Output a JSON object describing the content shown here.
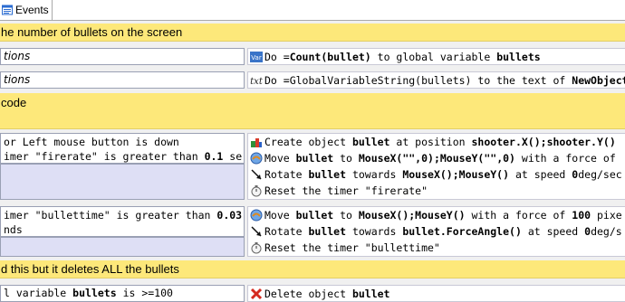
{
  "tab": {
    "label": "Events"
  },
  "comments": [
    "he number of bullets on the screen",
    "code",
    "d this but it deletes ALL the bullets"
  ],
  "events": [
    {
      "conditions": [
        "tions"
      ],
      "actions": [
        {
          "icon": "variable-icon",
          "parts": [
            {
              "t": "Do =",
              "b": false
            },
            {
              "t": "Count(bullet)",
              "b": true
            },
            {
              "t": " to global variable ",
              "b": false
            },
            {
              "t": "bullets",
              "b": true
            }
          ]
        }
      ]
    },
    {
      "conditions": [
        "tions"
      ],
      "actions": [
        {
          "icon": "text-icon",
          "parts": [
            {
              "t": "Do =GlobalVariableString(bullets) to the text of ",
              "b": false
            },
            {
              "t": "NewObject",
              "b": true
            }
          ]
        }
      ]
    },
    {
      "conditions": [
        [
          {
            "t": " or Left mouse button is down",
            "b": false
          }
        ],
        [
          {
            "t": "imer \"firerate\" is greater than ",
            "b": false
          },
          {
            "t": "0.1",
            "b": true
          },
          {
            "t": " se",
            "b": false
          }
        ]
      ],
      "actions": [
        {
          "icon": "create-object-icon",
          "parts": [
            {
              "t": "Create object ",
              "b": false
            },
            {
              "t": "bullet",
              "b": true
            },
            {
              "t": " at position ",
              "b": false
            },
            {
              "t": "shooter.X();shooter.Y()",
              "b": true
            }
          ]
        },
        {
          "icon": "force-icon",
          "parts": [
            {
              "t": "Move ",
              "b": false
            },
            {
              "t": "bullet",
              "b": true
            },
            {
              "t": " to ",
              "b": false
            },
            {
              "t": "MouseX(\"\",0);MouseY(\"\",0)",
              "b": true
            },
            {
              "t": " with a force of",
              "b": false
            }
          ]
        },
        {
          "icon": "rotate-icon",
          "parts": [
            {
              "t": "Rotate ",
              "b": false
            },
            {
              "t": "bullet",
              "b": true
            },
            {
              "t": " towards ",
              "b": false
            },
            {
              "t": "MouseX();MouseY()",
              "b": true
            },
            {
              "t": " at speed ",
              "b": false
            },
            {
              "t": "0",
              "b": true
            },
            {
              "t": "deg/sec",
              "b": false
            }
          ]
        },
        {
          "icon": "timer-icon",
          "parts": [
            {
              "t": "Reset the timer \"firerate\"",
              "b": false
            }
          ]
        }
      ]
    },
    {
      "conditions": [
        [
          {
            "t": "imer \"bullettime\" is greater than ",
            "b": false
          },
          {
            "t": "0.03",
            "b": true
          }
        ],
        [
          {
            "t": "nds",
            "b": false
          }
        ]
      ],
      "actions": [
        {
          "icon": "force-icon",
          "parts": [
            {
              "t": "Move ",
              "b": false
            },
            {
              "t": "bullet",
              "b": true
            },
            {
              "t": " to ",
              "b": false
            },
            {
              "t": "MouseX();MouseY()",
              "b": true
            },
            {
              "t": " with a force of ",
              "b": false
            },
            {
              "t": "100",
              "b": true
            },
            {
              "t": " pixe",
              "b": false
            }
          ]
        },
        {
          "icon": "rotate-icon",
          "parts": [
            {
              "t": "Rotate ",
              "b": false
            },
            {
              "t": "bullet",
              "b": true
            },
            {
              "t": " towards ",
              "b": false
            },
            {
              "t": "bullet.ForceAngle()",
              "b": true
            },
            {
              "t": " at speed ",
              "b": false
            },
            {
              "t": "0",
              "b": true
            },
            {
              "t": "deg/s",
              "b": false
            }
          ]
        },
        {
          "icon": "timer-icon",
          "parts": [
            {
              "t": "Reset the timer \"bullettime\"",
              "b": false
            }
          ]
        }
      ]
    },
    {
      "conditions": [
        [
          {
            "t": "l variable ",
            "b": false
          },
          {
            "t": "bullets",
            "b": true
          },
          {
            "t": " is >=100",
            "b": false
          }
        ]
      ],
      "actions": [
        {
          "icon": "delete-icon",
          "parts": [
            {
              "t": "Delete object ",
              "b": false
            },
            {
              "t": "bullet",
              "b": true
            }
          ]
        }
      ]
    }
  ]
}
